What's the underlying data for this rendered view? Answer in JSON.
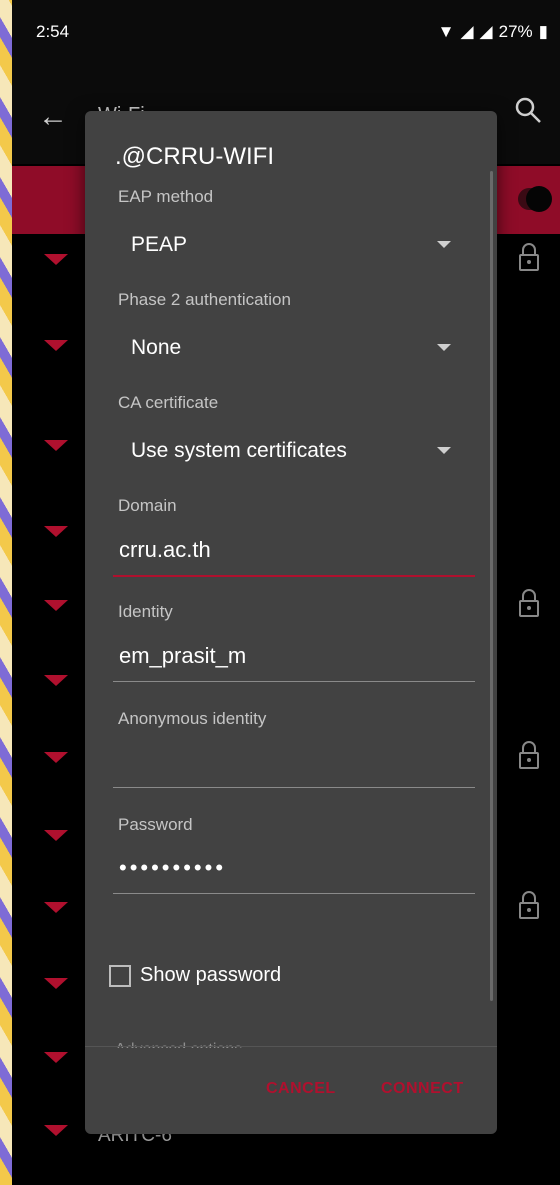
{
  "status_bar": {
    "time": "2:54",
    "battery": "27%"
  },
  "app_bar": {
    "title": "Wi-Fi"
  },
  "networks": [
    {
      "name": "",
      "locked": true
    },
    {
      "name": "",
      "locked": false
    },
    {
      "name": "",
      "locked": false
    },
    {
      "name": "",
      "locked": false
    },
    {
      "name": "",
      "locked": true
    },
    {
      "name": "",
      "locked": false
    },
    {
      "name": "",
      "locked": true
    },
    {
      "name": "",
      "locked": false
    },
    {
      "name": "",
      "locked": true
    },
    {
      "name": "",
      "locked": false
    },
    {
      "name": "",
      "locked": false
    },
    {
      "name": "ARITC-6",
      "locked": false
    }
  ],
  "dialog": {
    "title": ".@CRRU-WIFI",
    "eap_method": {
      "label": "EAP method",
      "value": "PEAP"
    },
    "phase2": {
      "label": "Phase 2 authentication",
      "value": "None"
    },
    "ca_certificate": {
      "label": "CA certificate",
      "value": "Use system certificates"
    },
    "domain": {
      "label": "Domain",
      "value": "crru.ac.th"
    },
    "identity": {
      "label": "Identity",
      "value": "em_prasit_m"
    },
    "anonymous_identity": {
      "label": "Anonymous identity",
      "value": ""
    },
    "password": {
      "label": "Password",
      "value": "••••••••••"
    },
    "show_password_label": "Show password",
    "advanced_label": "Advanced options",
    "cancel_label": "CANCEL",
    "connect_label": "CONNECT"
  },
  "colors": {
    "accent": "#b0102e",
    "dialog_bg": "#424242",
    "toggle_row": "#8f0c28"
  },
  "icons": [
    "back-arrow-icon",
    "search-icon",
    "wifi-signal-icon",
    "lock-icon",
    "battery-icon"
  ]
}
